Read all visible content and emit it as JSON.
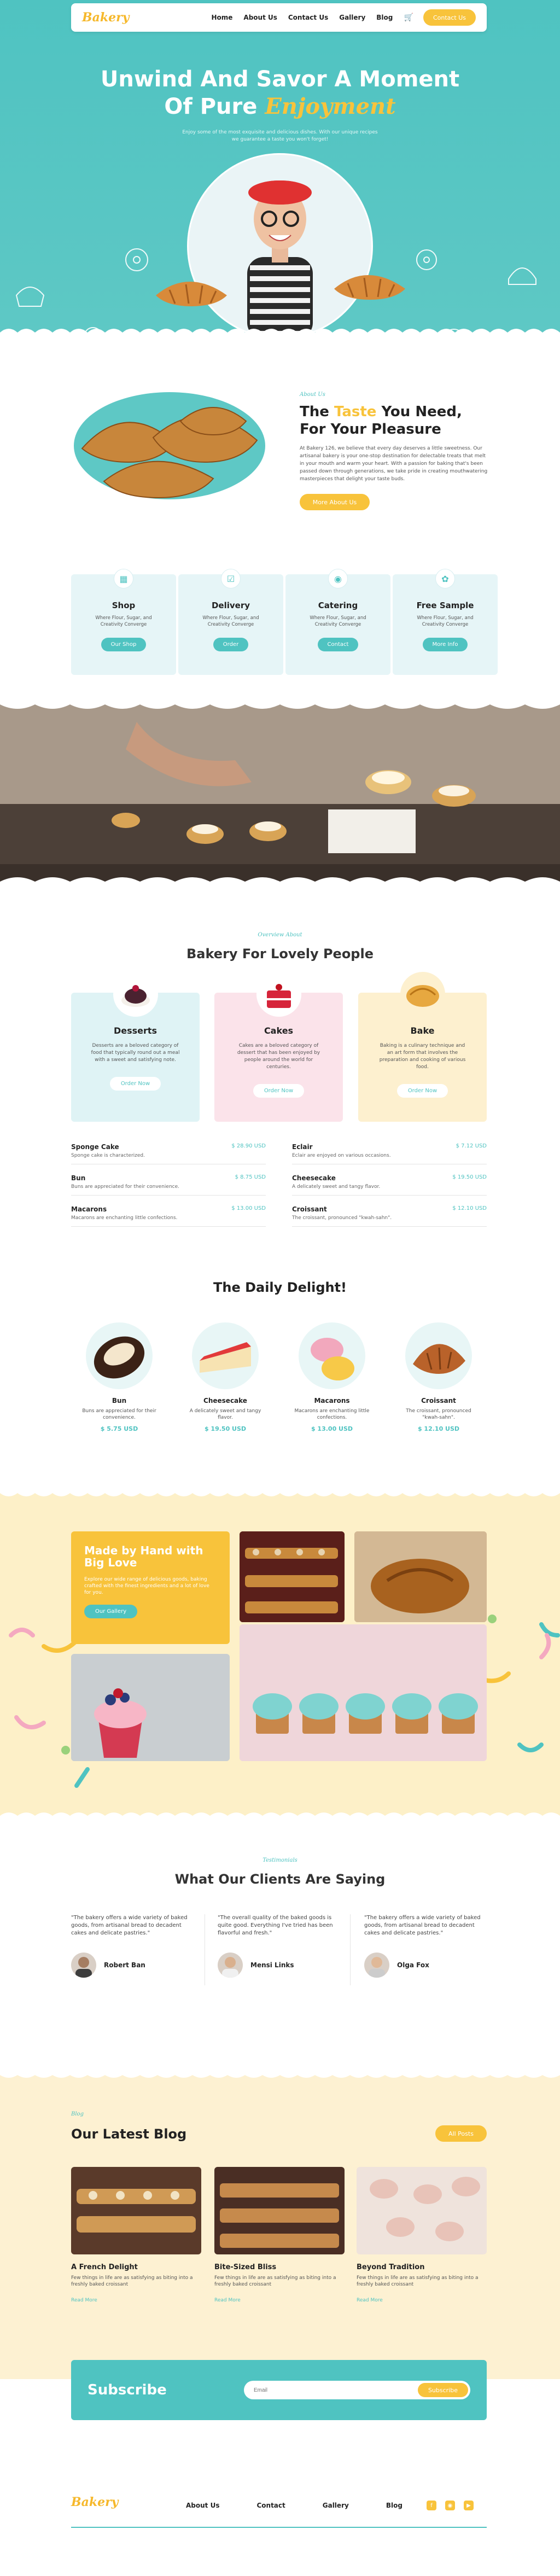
{
  "nav": {
    "logo": "Bakery",
    "links": [
      "Home",
      "About Us",
      "Contact Us",
      "Gallery",
      "Blog"
    ],
    "cta": "Contact Us"
  },
  "hero": {
    "title_line1": "Unwind And Savor A Moment",
    "title_line2_prefix": "Of Pure",
    "title_line2_emph": "Enjoyment",
    "subtitle_line1": "Enjoy some of the most exquisite and delicious dishes. With our unique recipes",
    "subtitle_line2": "we guarantee a taste you won't forget!"
  },
  "about": {
    "kicker": "About Us",
    "title_prefix": "The",
    "title_emph": "Taste",
    "title_rest": "You Need,",
    "title_line2": "For Your Pleasure",
    "body": "At Bakery 126, we believe that every day deserves a little sweetness. Our artisanal bakery is your one-stop destination for delectable treats that melt in your mouth and warm your heart. With a passion for baking that's been passed down through generations, we take pride in creating mouthwatering masterpieces that delight your taste buds.",
    "cta": "More About Us"
  },
  "services": [
    {
      "icon": "shop-icon",
      "title": "Shop",
      "desc": "Where Flour, Sugar, and Creativity Converge",
      "btn": "Our Shop"
    },
    {
      "icon": "delivery-icon",
      "title": "Delivery",
      "desc": "Where Flour, Sugar, and Creativity Converge",
      "btn": "Order"
    },
    {
      "icon": "catering-icon",
      "title": "Catering",
      "desc": "Where Flour, Sugar, and Creativity Converge",
      "btn": "Contact"
    },
    {
      "icon": "sample-icon",
      "title": "Free Sample",
      "desc": "Where Flour, Sugar, and Creativity Converge",
      "btn": "More Info"
    }
  ],
  "bakery": {
    "kicker": "Overview About",
    "title": "Bakery For Lovely People",
    "cards": [
      {
        "title": "Desserts",
        "desc": "Desserts are a beloved category of food that typically round out a meal with a sweet and satisfying note.",
        "btn": "Order Now",
        "bg": "#dff3f5"
      },
      {
        "title": "Cakes",
        "desc": "Cakes are a beloved category of dessert that has been enjoyed by people around the world for centuries.",
        "btn": "Order Now",
        "bg": "#fbe3ea"
      },
      {
        "title": "Bake",
        "desc": "Baking is a culinary technique and an art form that involves the preparation and cooking of various food.",
        "btn": "Order Now",
        "bg": "#fdf0cf"
      }
    ],
    "menu": [
      {
        "name": "Sponge Cake",
        "price": "$ 28.90 USD",
        "desc": "Sponge cake is characterized."
      },
      {
        "name": "Eclair",
        "price": "$ 7.12 USD",
        "desc": "Eclair are enjoyed on various occasions."
      },
      {
        "name": "Bun",
        "price": "$ 8.75 USD",
        "desc": "Buns are appreciated for their convenience."
      },
      {
        "name": "Cheesecake",
        "price": "$ 19.50 USD",
        "desc": "A delicately sweet and tangy flavor."
      },
      {
        "name": "Macarons",
        "price": "$ 13.00 USD",
        "desc": "Macarons are enchanting little confections."
      },
      {
        "name": "Croissant",
        "price": "$ 12.10 USD",
        "desc": "The croissant, pronounced \"kwah-sahn\"."
      }
    ]
  },
  "daily": {
    "title": "The Daily Delight!",
    "items": [
      {
        "name": "Bun",
        "desc": "Buns are appreciated for their convenience.",
        "price": "$ 5.75 USD"
      },
      {
        "name": "Cheesecake",
        "desc": "A delicately sweet and tangy flavor.",
        "price": "$ 19.50 USD"
      },
      {
        "name": "Macarons",
        "desc": "Macarons are enchanting little confections.",
        "price": "$ 13.00 USD"
      },
      {
        "name": "Croissant",
        "desc": "The croissant, pronounced \"kwah-sahn\".",
        "price": "$ 12.10 USD"
      }
    ]
  },
  "gallery": {
    "title_line1": "Made by Hand with",
    "title_line2": "Big Love",
    "desc": "Explore our wide range of delicious goods, baking crafted with the finest ingredients and a lot of love for you.",
    "btn": "Our Gallery"
  },
  "testimonials": {
    "kicker": "Testimonials",
    "title": "What Our Clients Are Saying",
    "items": [
      {
        "quote": "\"The bakery offers a wide variety of baked goods, from artisanal bread to decadent cakes and delicate pastries.\"",
        "name": "Robert Ban"
      },
      {
        "quote": "\"The overall quality of the baked goods is quite good. Everything I've tried has been flavorful and fresh.\"",
        "name": "Mensi Links"
      },
      {
        "quote": "\"The bakery offers a wide variety of baked goods, from artisanal bread to decadent cakes and delicate pastries.\"",
        "name": "Olga Fox"
      }
    ]
  },
  "blog": {
    "kicker": "Blog",
    "title": "Our Latest Blog",
    "all_btn": "All Posts",
    "posts": [
      {
        "title": "A French Delight",
        "desc": "Few things in life are as satisfying as biting into a freshly baked croissant",
        "more": "Read More"
      },
      {
        "title": "Bite-Sized Bliss",
        "desc": "Few things in life are as satisfying as biting into a freshly baked croissant",
        "more": "Read More"
      },
      {
        "title": "Beyond Tradition",
        "desc": "Few things in life are as satisfying as biting into a freshly baked croissant",
        "more": "Read More"
      }
    ]
  },
  "subscribe": {
    "title": "Subscribe",
    "placeholder": "Email",
    "btn": "Subscribe"
  },
  "footer": {
    "logo": "Bakery",
    "links": [
      "About Us",
      "Contact",
      "Gallery",
      "Blog"
    ],
    "social": [
      "facebook-icon",
      "instagram-icon",
      "youtube-icon"
    ]
  },
  "colors": {
    "teal": "#4fc3c1",
    "yellow": "#f8c33b",
    "cream": "#fdf0c8"
  }
}
